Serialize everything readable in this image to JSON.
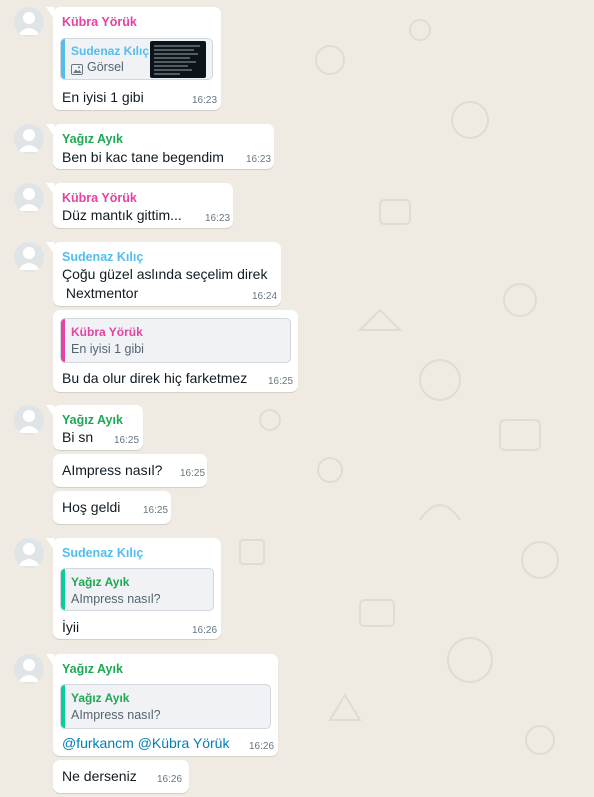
{
  "colors": {
    "kubra": "#e542a3",
    "yagiz": "#1fa855",
    "sudenaz": "#53bdeb",
    "mention": "#027eb5",
    "background": "#efeae2"
  },
  "messages": [
    {
      "sender": "Kübra Yörük",
      "quote": {
        "name": "Sudenaz Kılıç",
        "text": "Görsel",
        "icon": "image-icon"
      },
      "text": "En iyisi 1 gibi",
      "time": "16:23"
    },
    {
      "sender": "Yağız Ayık",
      "text": "Ben bi kac tane begendim",
      "time": "16:23"
    },
    {
      "sender": "Kübra Yörük",
      "text": "Düz mantık gittim...",
      "time": "16:23"
    },
    {
      "sender": "Sudenaz Kılıç",
      "line1": "Çoğu güzel aslında seçelim direk",
      "line2": " Nextmentor",
      "time": "16:24"
    },
    {
      "quote": {
        "name": "Kübra Yörük",
        "text": "En iyisi 1 gibi"
      },
      "text": "Bu da olur direk hiç farketmez",
      "time": "16:25"
    },
    {
      "sender": "Yağız Ayık",
      "text": "Bi sn",
      "time": "16:25"
    },
    {
      "text": "AImpress nasıl?",
      "time": "16:25"
    },
    {
      "text": "Hoş geldi",
      "time": "16:25"
    },
    {
      "sender": "Sudenaz Kılıç",
      "quote": {
        "name": "Yağız Ayık",
        "text": "AImpress nasıl?"
      },
      "text": "İyii",
      "time": "16:26"
    },
    {
      "sender": "Yağız Ayık",
      "quote": {
        "name": "Yağız Ayık",
        "text": "AImpress nasıl?"
      },
      "mention1": "@furkancm",
      "mention2": "@Kübra Yörük",
      "time": "16:26"
    },
    {
      "text": "Ne derseniz",
      "time": "16:26"
    }
  ]
}
